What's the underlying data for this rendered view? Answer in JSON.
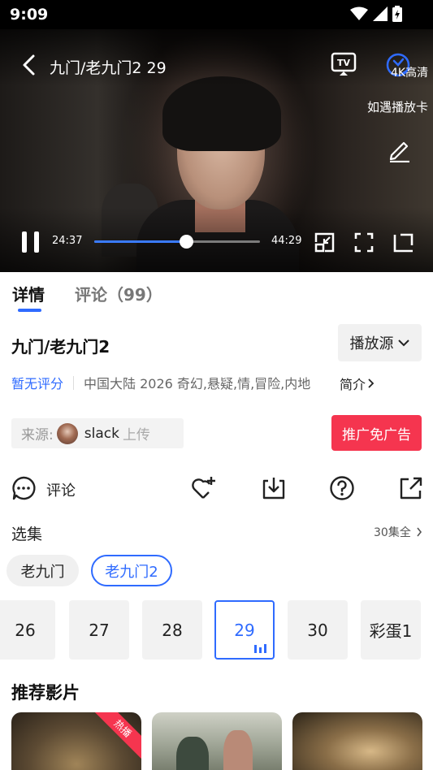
{
  "status_bar": {
    "time": "9:09",
    "icons": [
      "wifi-icon",
      "signal-icon",
      "battery-icon"
    ]
  },
  "player": {
    "title": "九门/老九门2 29",
    "quality": "4K高清",
    "tip": "如遇播放卡",
    "current_time": "24:37",
    "total_time": "44:29",
    "progress_fraction": 0.553,
    "icons": [
      "back-icon",
      "tv-cast-icon",
      "speed-icon",
      "edit-icon",
      "pause-icon",
      "pip-icon",
      "fullscreen-icon",
      "rotate-icon"
    ]
  },
  "tabs": [
    {
      "label": "详情",
      "active": true
    },
    {
      "label": "评论（99）",
      "active": false
    }
  ],
  "detail": {
    "title": "九门/老九门2",
    "source_button": "播放源",
    "rating": "暂无评分",
    "meta": "中国大陆  2026  奇幻,悬疑,情,冒险,内地",
    "intro_link": "简介"
  },
  "uploader": {
    "label": "来源:",
    "name": "slack",
    "suffix": "上传"
  },
  "promo_button": "推广免广告",
  "actions": {
    "comment_label": "评论",
    "icons": [
      "comment-icon",
      "favorite-add-icon",
      "download-icon",
      "help-icon",
      "share-icon"
    ]
  },
  "episodes": {
    "label": "选集",
    "total": "30集全",
    "seasons": [
      {
        "label": "老九门",
        "active": false
      },
      {
        "label": "老九门2",
        "active": true
      }
    ],
    "items": [
      {
        "label": "26",
        "active": false
      },
      {
        "label": "27",
        "active": false
      },
      {
        "label": "28",
        "active": false
      },
      {
        "label": "29",
        "active": true
      },
      {
        "label": "30",
        "active": false
      },
      {
        "label": "彩蛋1",
        "active": false
      }
    ]
  },
  "recommend": {
    "label": "推荐影片",
    "hot_badge": "热播"
  },
  "colors": {
    "accent": "#2f6bff",
    "promo": "#f5354f"
  }
}
